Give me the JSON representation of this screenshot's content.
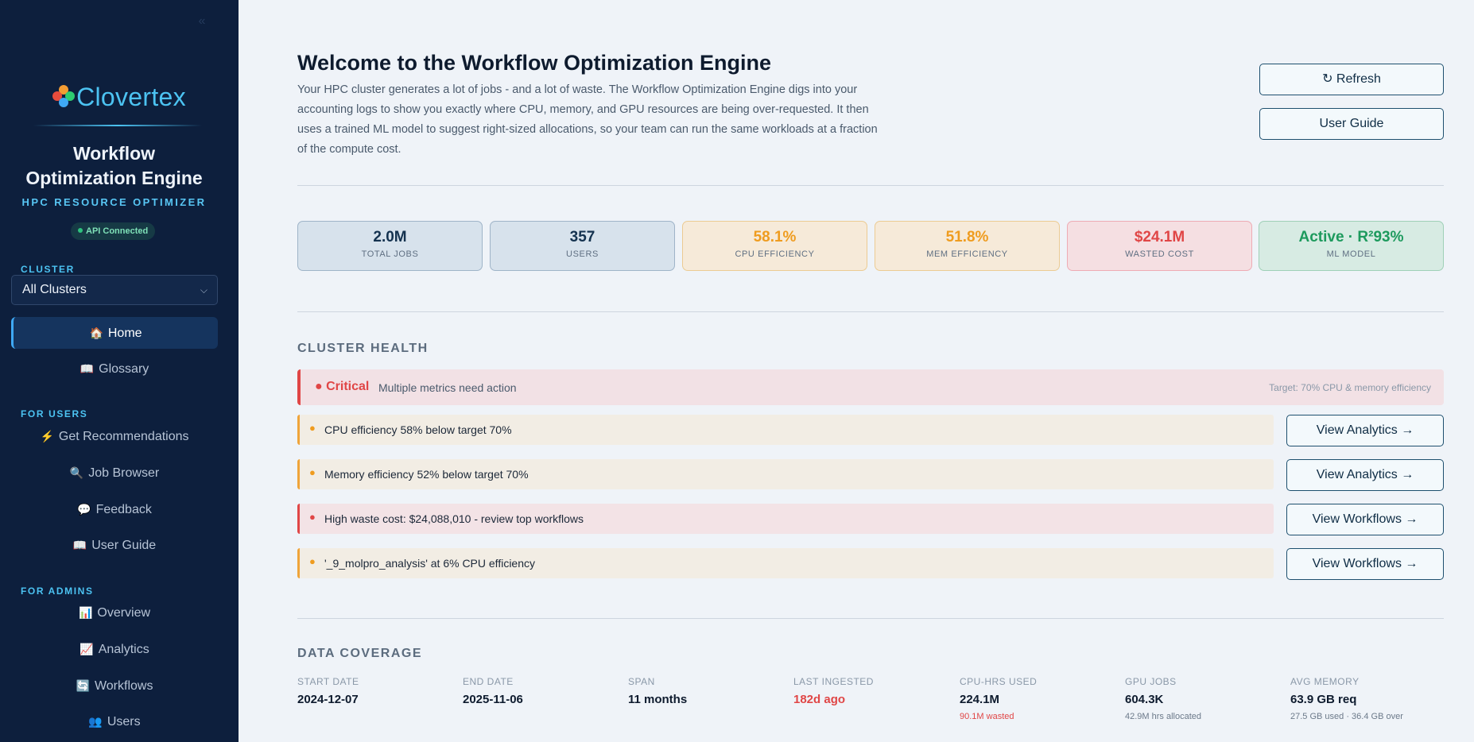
{
  "sidebar": {
    "collapse_glyph": "«",
    "brand": "Clovertex",
    "app_title_line1": "Workflow",
    "app_title_line2": "Optimization Engine",
    "app_subtitle": "HPC RESOURCE OPTIMIZER",
    "api_status": "API Connected",
    "cluster_label": "CLUSTER",
    "cluster_value": "All Clusters",
    "nav_home": {
      "icon": "🏠",
      "label": "Home"
    },
    "nav_glossary": {
      "icon": "📖",
      "label": "Glossary"
    },
    "section_users": "FOR USERS",
    "users_items": [
      {
        "icon": "⚡",
        "label": "Get Recommendations"
      },
      {
        "icon": "🔍",
        "label": "Job Browser"
      },
      {
        "icon": "💬",
        "label": "Feedback"
      },
      {
        "icon": "📖",
        "label": "User Guide"
      }
    ],
    "section_admins": "FOR ADMINS",
    "admin_items": [
      {
        "icon": "📊",
        "label": "Overview"
      },
      {
        "icon": "📈",
        "label": "Analytics"
      },
      {
        "icon": "🔄",
        "label": "Workflows"
      },
      {
        "icon": "👥",
        "label": "Users"
      }
    ]
  },
  "header": {
    "title": "Welcome to the Workflow Optimization Engine",
    "intro": "Your HPC cluster generates a lot of jobs - and a lot of waste. The Workflow Optimization Engine digs into your accounting logs to show you exactly where CPU, memory, and GPU resources are being over-requested. It then uses a trained ML model to suggest right-sized allocations, so your team can run the same workloads at a fraction of the compute cost.",
    "refresh_label": "↻ Refresh",
    "user_guide_label": "User Guide"
  },
  "kpis": [
    {
      "value": "2.0M",
      "label": "TOTAL JOBS"
    },
    {
      "value": "357",
      "label": "USERS"
    },
    {
      "value": "58.1%",
      "label": "CPU EFFICIENCY"
    },
    {
      "value": "51.8%",
      "label": "MEM EFFICIENCY"
    },
    {
      "value": "$24.1M",
      "label": "WASTED COST"
    },
    {
      "value": "Active · R²93%",
      "label": "ML MODEL"
    }
  ],
  "health": {
    "section_title": "CLUSTER HEALTH",
    "status": "● Critical",
    "status_message": "Multiple metrics need action",
    "target_note": "Target: 70% CPU & memory efficiency",
    "issues": [
      {
        "text": "CPU efficiency 58% below target 70%",
        "action": "View Analytics →"
      },
      {
        "text": "Memory efficiency 52% below target 70%",
        "action": "View Analytics →"
      },
      {
        "text": "High waste cost: $24,088,010 - review top workflows",
        "action": "View Workflows →"
      },
      {
        "text": "'_9_molpro_analysis' at 6% CPU efficiency",
        "action": "View Workflows →"
      }
    ]
  },
  "coverage": {
    "section_title": "DATA COVERAGE",
    "items": [
      {
        "label": "START DATE",
        "value": "2024-12-07",
        "sub": ""
      },
      {
        "label": "END DATE",
        "value": "2025-11-06",
        "sub": ""
      },
      {
        "label": "SPAN",
        "value": "11 months",
        "sub": ""
      },
      {
        "label": "LAST INGESTED",
        "value": "182d ago",
        "sub": ""
      },
      {
        "label": "CPU-HRS USED",
        "value": "224.1M",
        "sub": "90.1M wasted"
      },
      {
        "label": "GPU JOBS",
        "value": "604.3K",
        "sub": "42.9M hrs allocated"
      },
      {
        "label": "AVG MEMORY",
        "value": "63.9 GB req",
        "sub": "27.5 GB used · 36.4 GB over"
      }
    ]
  },
  "colors": {
    "sidebar_bg": "#0d1f3d",
    "accent": "#4cc3f2",
    "critical": "#e04646",
    "warning": "#ef9c1f",
    "success": "#1d9a5d"
  }
}
